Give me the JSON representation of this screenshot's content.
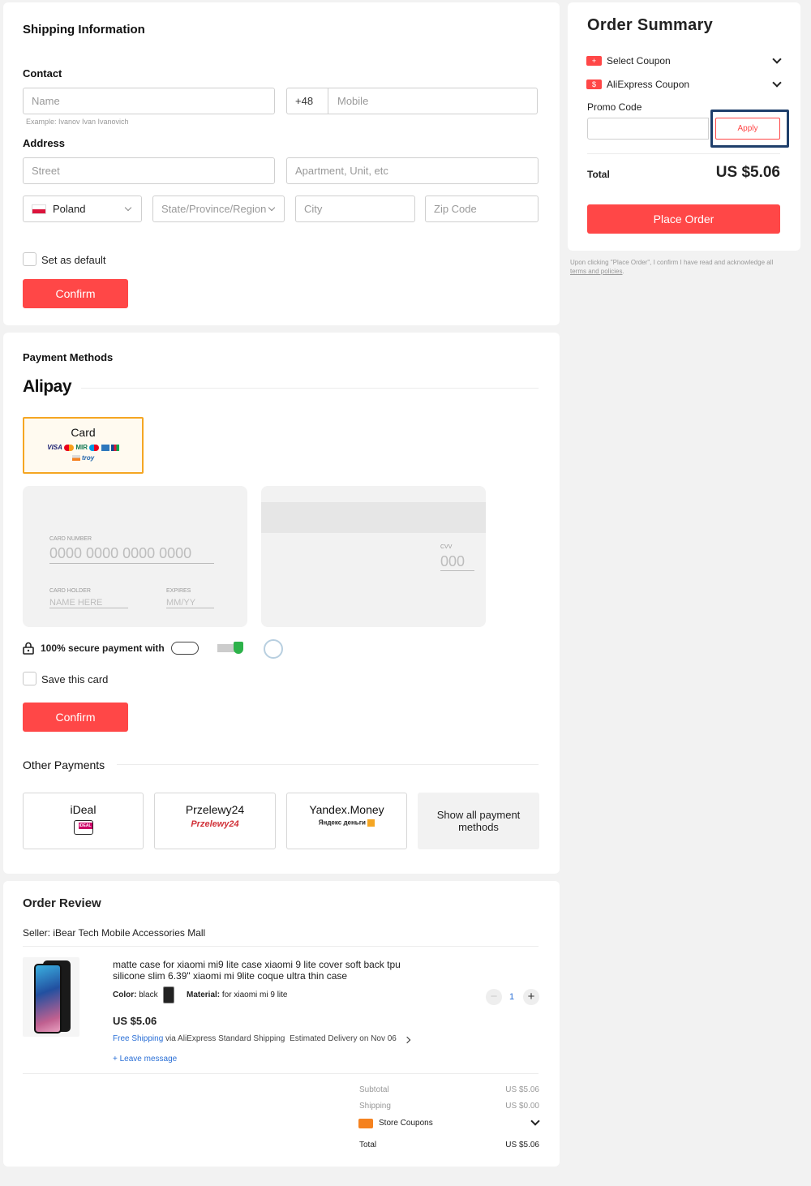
{
  "shipping": {
    "title": "Shipping Information",
    "contact_label": "Contact",
    "name_placeholder": "Name",
    "country_code": "+48",
    "mobile_placeholder": "Mobile",
    "name_example": "Example: Ivanov Ivan Ivanovich",
    "address_label": "Address",
    "street_placeholder": "Street",
    "apartment_placeholder": "Apartment, Unit, etc",
    "country": "Poland",
    "state_placeholder": "State/Province/Region",
    "city_placeholder": "City",
    "zip_placeholder": "Zip Code",
    "default_label": "Set as default",
    "confirm_label": "Confirm"
  },
  "payment": {
    "title": "Payment Methods",
    "provider": "Alipay",
    "card_tab_label": "Card",
    "card_brands": [
      "VISA",
      "MIR",
      "troy"
    ],
    "card_number_label": "CARD NUMBER",
    "card_number_placeholder": "0000 0000 0000 0000",
    "card_holder_label": "CARD HOLDER",
    "card_holder_placeholder": "NAME HERE",
    "expires_label": "EXPIRES",
    "expires_placeholder": "MM/YY",
    "cvv_label": "CVV",
    "cvv_placeholder": "000",
    "secure_text": "100% secure payment with",
    "save_card_label": "Save this card",
    "confirm_label": "Confirm",
    "other_title": "Other Payments",
    "other_methods": [
      {
        "name": "iDeal",
        "logo": "iDEAL"
      },
      {
        "name": "Przelewy24",
        "logo": "Przelewy24"
      },
      {
        "name": "Yandex.Money",
        "logo": "Яндекс деньги"
      }
    ],
    "show_all_label": "Show all payment methods"
  },
  "review": {
    "title": "Order Review",
    "seller": "Seller: iBear Tech Mobile Accessories Mall",
    "item": {
      "title": "matte case for xiaomi mi9 lite case xiaomi 9 lite cover soft back tpu silicone slim 6.39\" xiaomi mi 9lite coque ultra thin case",
      "color_label": "Color:",
      "color_value": "black",
      "material_label": "Material:",
      "material_value": "for xiaomi mi 9 lite",
      "quantity": "1",
      "price": "US $5.06",
      "free_shipping": "Free Shipping",
      "shipping_via": "via AliExpress Standard Shipping",
      "estimated": "Estimated Delivery on",
      "delivery_date": "Nov 06",
      "leave_message": "+ Leave message"
    },
    "subtotal_label": "Subtotal",
    "subtotal_value": "US $5.06",
    "shipping_label": "Shipping",
    "shipping_value": "US $0.00",
    "store_coupons_label": "Store Coupons",
    "total_label": "Total",
    "total_value": "US $5.06"
  },
  "summary": {
    "title": "Order Summary",
    "select_coupon": "Select Coupon",
    "aliexpress_coupon": "AliExpress Coupon",
    "promo_label": "Promo Code",
    "apply_label": "Apply",
    "total_label": "Total",
    "total_value": "US $5.06",
    "place_order_label": "Place Order",
    "terms_text": "Upon clicking \"Place Order\", I confirm I have read and acknowledge all",
    "terms_link": "terms and policies",
    "terms_end": "."
  },
  "colors": {
    "accent": "#ff4747",
    "card_tab_border": "#f5a623",
    "link": "#2a6fd6",
    "highlight_border": "#1f3f6b"
  }
}
